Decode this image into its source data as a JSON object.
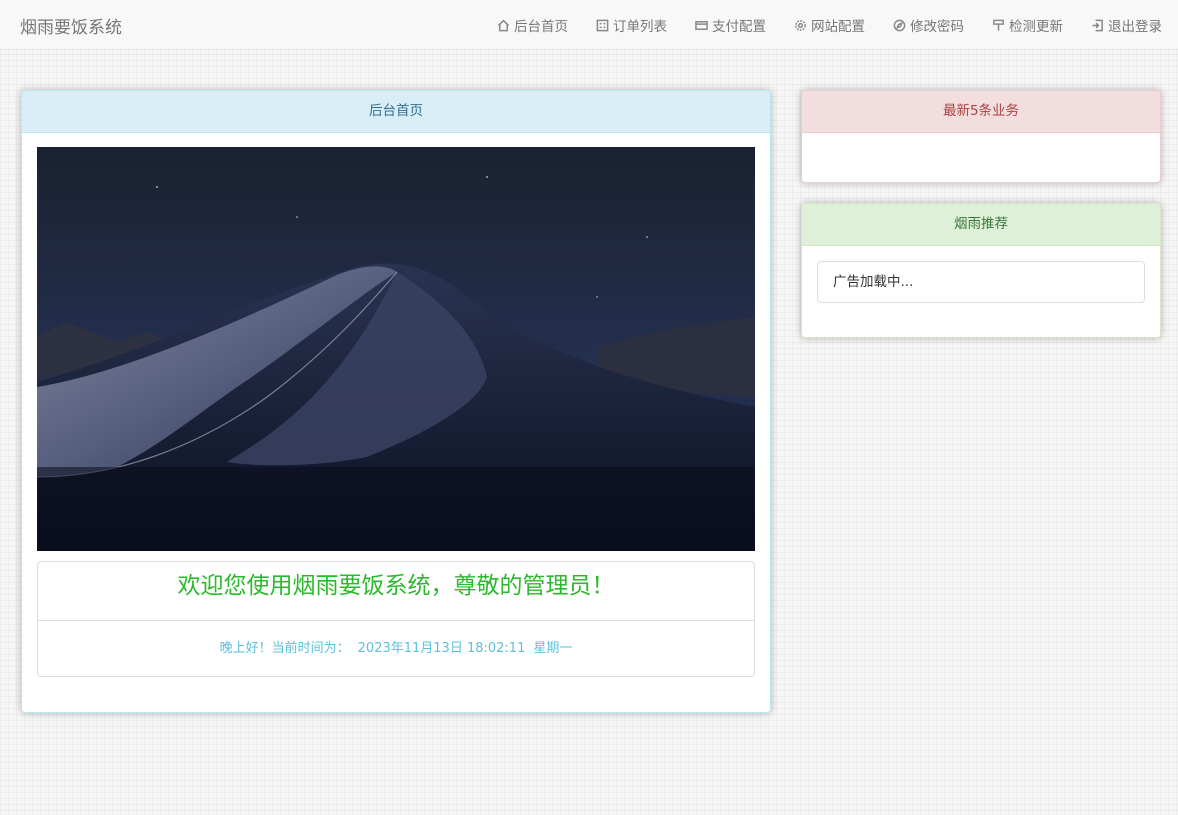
{
  "navbar": {
    "brand": "烟雨要饭系统",
    "items": [
      {
        "label": "后台首页",
        "icon": "home-icon"
      },
      {
        "label": "订单列表",
        "icon": "list-icon"
      },
      {
        "label": "支付配置",
        "icon": "credit-card-icon"
      },
      {
        "label": "网站配置",
        "icon": "gear-icon"
      },
      {
        "label": "修改密码",
        "icon": "compass-icon"
      },
      {
        "label": "检测更新",
        "icon": "brush-icon"
      },
      {
        "label": "退出登录",
        "icon": "logout-icon"
      }
    ]
  },
  "main_panel": {
    "heading": "后台首页",
    "welcome": "欢迎您使用烟雨要饭系统，尊敬的管理员！",
    "greeting": "晚上好！当前时间为：",
    "datetime": "2023年11月13日 18:02:11",
    "weekday": "星期一"
  },
  "latest_panel": {
    "heading": "最新5条业务"
  },
  "recommend_panel": {
    "heading": "烟雨推荐",
    "ad_text": "广告加载中..."
  },
  "colors": {
    "info_heading": "#d9edf7",
    "danger_heading": "#f2dede",
    "success_heading": "#dff0d8",
    "welcome_text": "#2db92d",
    "time_text": "#5bc0de"
  }
}
